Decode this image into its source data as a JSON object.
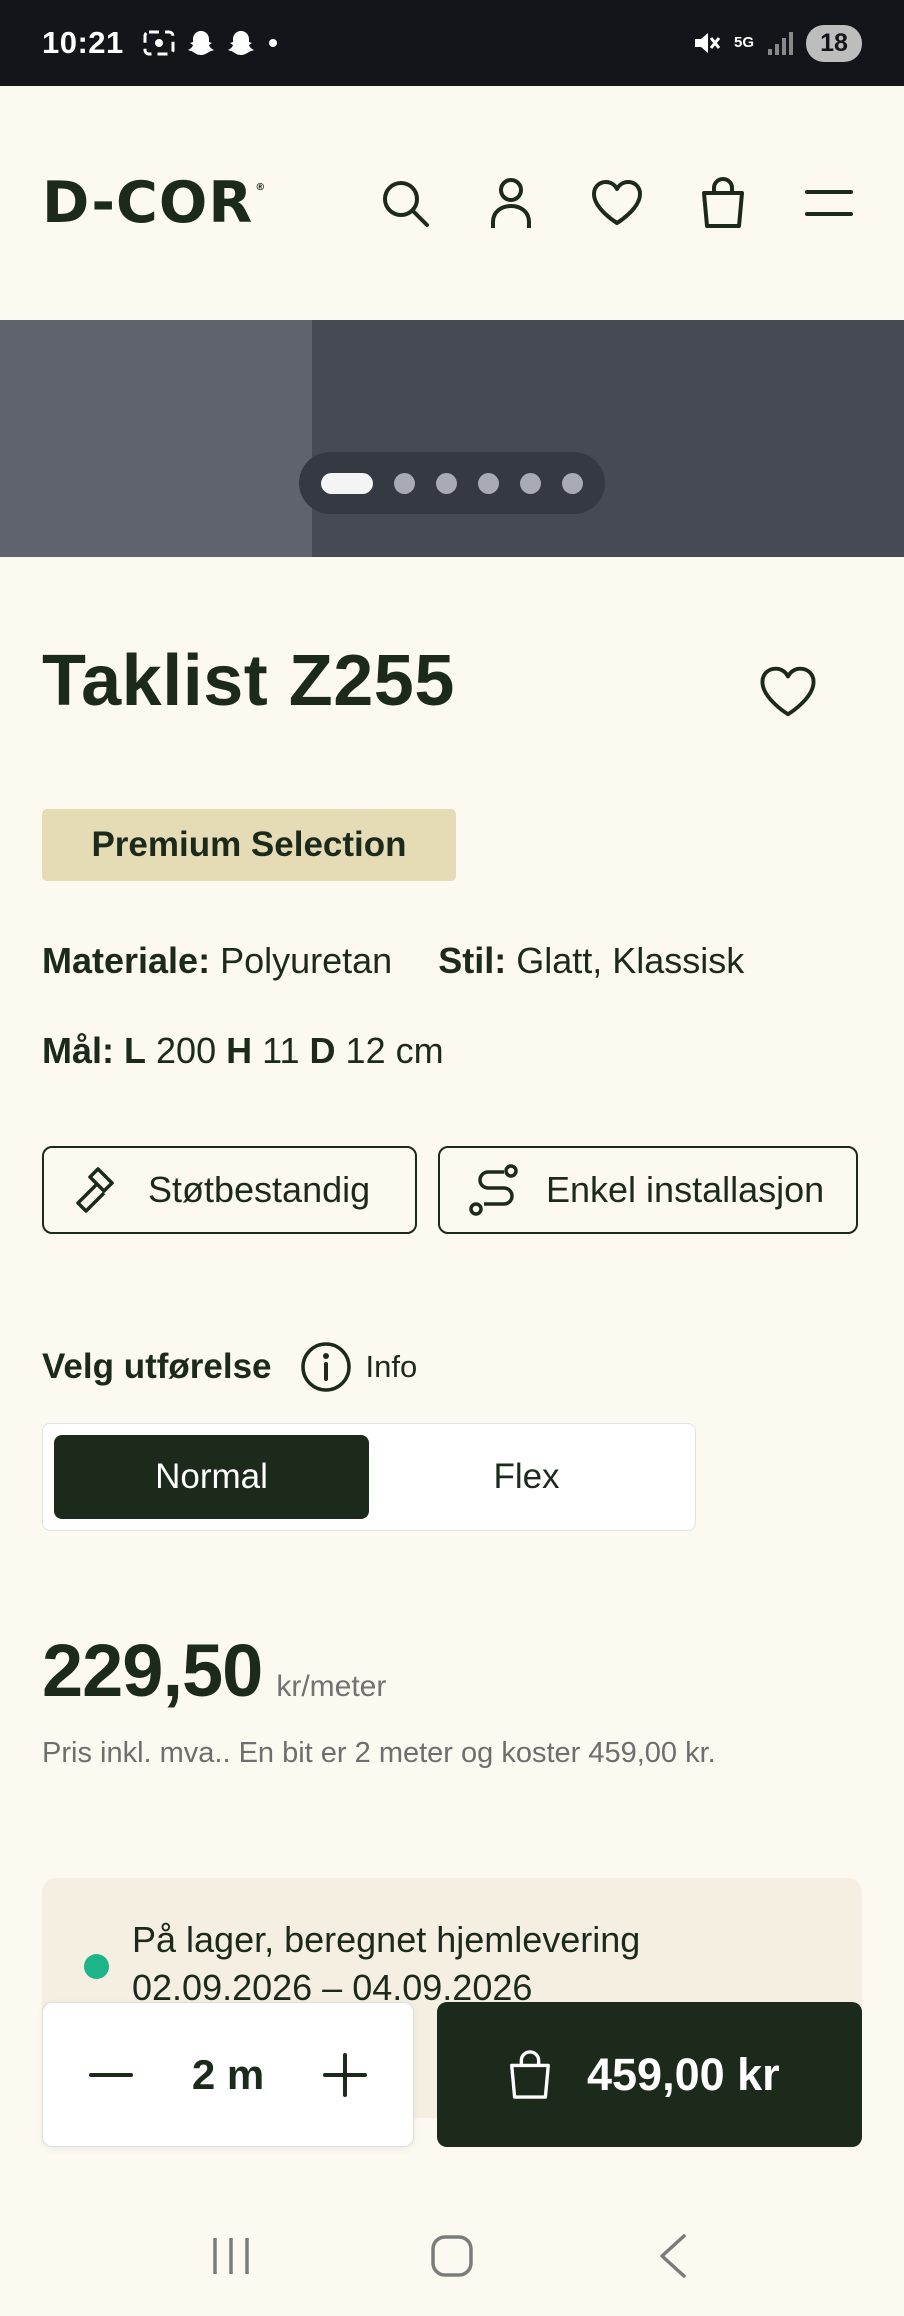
{
  "status_bar": {
    "time": "10:21",
    "network": "5G",
    "battery": "18"
  },
  "header": {
    "logo": "D-COR",
    "logo_mark": "®",
    "icons": [
      "search-icon",
      "account-icon",
      "heart-icon",
      "bag-icon",
      "menu-icon"
    ]
  },
  "carousel": {
    "slide_count": 6,
    "active_index": 0
  },
  "product": {
    "title": "Taklist Z255",
    "badge": "Premium Selection",
    "material_label": "Materiale:",
    "material_value": "Polyuretan",
    "style_label": "Stil:",
    "style_value": "Glatt, Klassisk",
    "dims_label": "Mål:",
    "dim_l_label": "L",
    "dim_l_value": "200",
    "dim_h_label": "H",
    "dim_h_value": "11",
    "dim_d_label": "D",
    "dim_d_value": "12 cm"
  },
  "features": {
    "item1": "Støtbestandig",
    "item2": "Enkel installasjon"
  },
  "variant": {
    "heading": "Velg utførelse",
    "info_label": "Info",
    "options": [
      "Normal",
      "Flex"
    ],
    "selected": "Normal"
  },
  "price": {
    "value": "229,50",
    "unit": "kr/meter",
    "note": "Pris inkl. mva.. En bit er 2 meter og koster 459,00 kr."
  },
  "stock": {
    "line1": "På lager, beregnet hjemlevering",
    "line2": "02.09.2026 – 04.09.2026",
    "color": "#1DB488"
  },
  "purchase": {
    "quantity": "2 m",
    "cart_price": "459,00 kr"
  },
  "colors": {
    "brand_dark": "#1C2A1C",
    "background": "#FCF9F1",
    "badge": "#E5DCB6"
  }
}
